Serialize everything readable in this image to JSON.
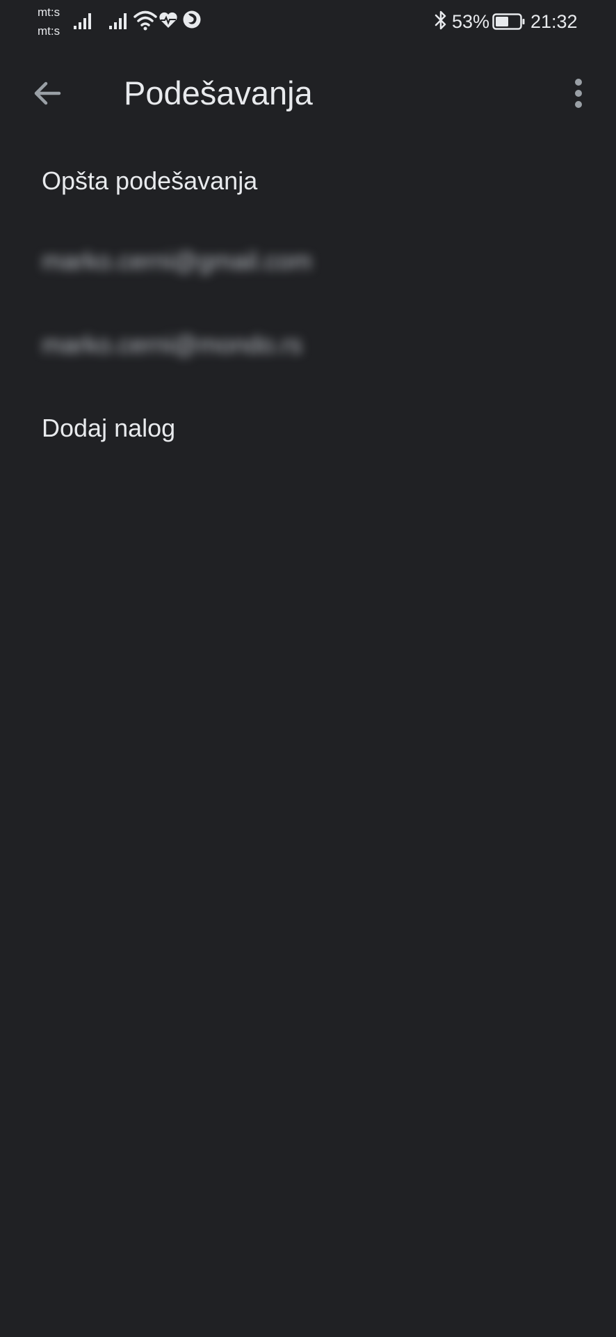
{
  "status_bar": {
    "carrier_1": "mt:s",
    "carrier_2": "mt:s",
    "battery_percent": "53%",
    "battery_level": 0.53,
    "time": "21:32",
    "icons": [
      "signal-icon",
      "signal-icon",
      "wifi-icon",
      "health-icon",
      "firefox-icon",
      "bluetooth-icon",
      "battery-icon"
    ]
  },
  "app_bar": {
    "title": "Podešavanja",
    "back_icon": "arrow-back-icon",
    "menu_icon": "more-vert-icon"
  },
  "settings_list": {
    "general": "Opšta podešavanja",
    "accounts": [
      {
        "email": "marko.cerni@gmail.com"
      },
      {
        "email": "marko.cerni@mondo.rs"
      }
    ],
    "add_account": "Dodaj nalog"
  },
  "colors": {
    "background": "#202124",
    "text": "#e8eaed",
    "icon": "#9aa0a6"
  }
}
